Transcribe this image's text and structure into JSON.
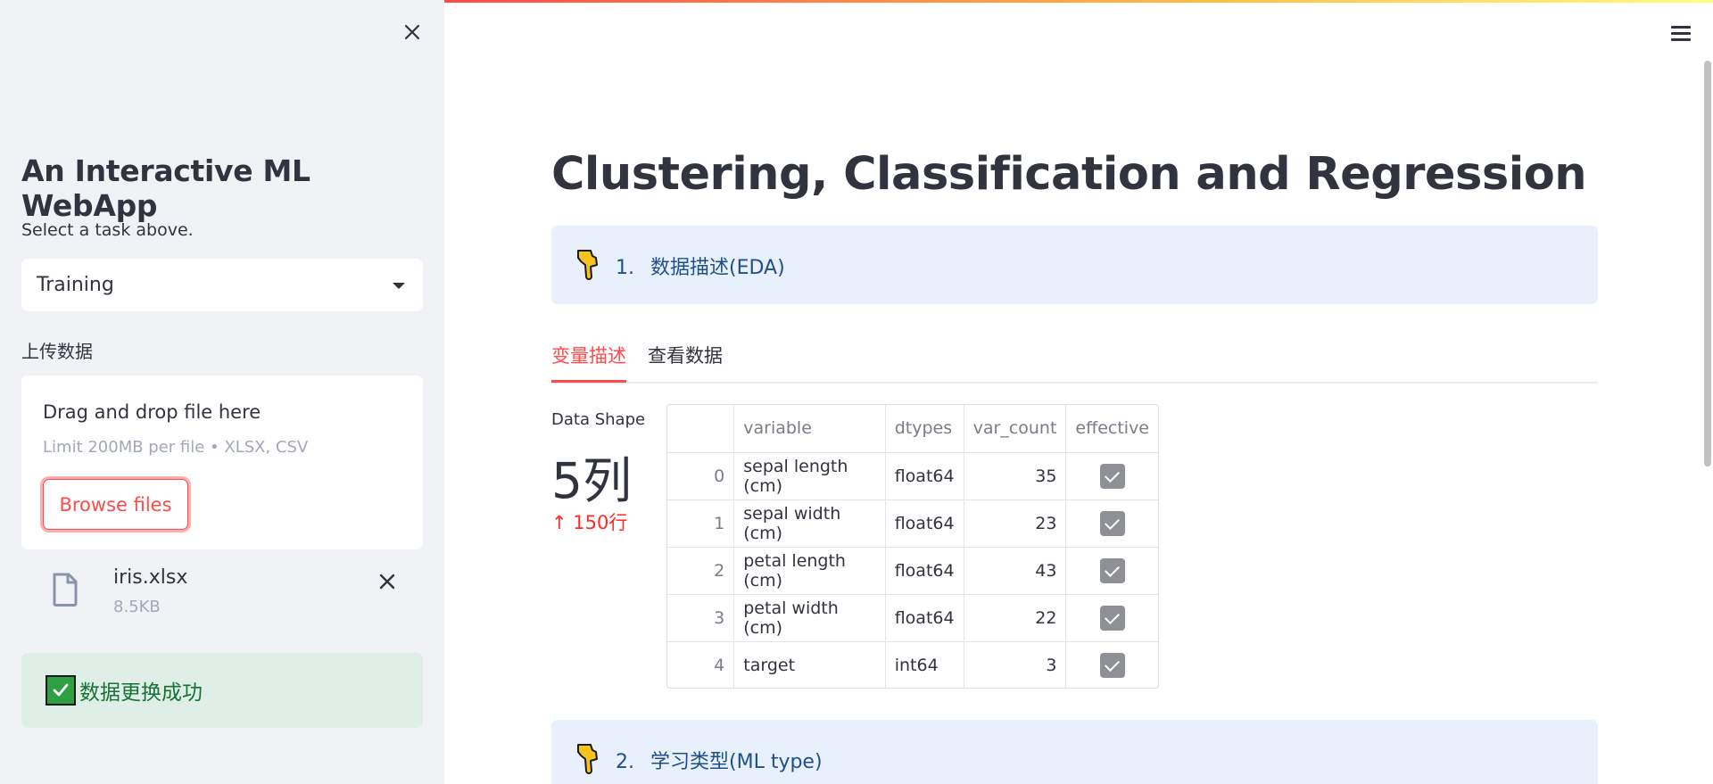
{
  "sidebar": {
    "title": "An Interactive ML WebApp",
    "subtitle": "Select a task above.",
    "task_select": {
      "value": "Training"
    },
    "upload_label": "上传数据",
    "dropzone": {
      "title": "Drag and drop file here",
      "limit": "Limit 200MB per file • XLSX, CSV",
      "browse_label": "Browse files"
    },
    "file": {
      "name": "iris.xlsx",
      "size": "8.5KB"
    },
    "success_message": "数据更换成功"
  },
  "main": {
    "title": "Clustering, Classification and Regression",
    "sections": [
      {
        "number": "1.",
        "label": "数据描述(EDA)"
      },
      {
        "number": "2.",
        "label": "学习类型(ML type)"
      }
    ],
    "tabs": [
      "变量描述",
      "查看数据"
    ],
    "metric": {
      "label": "Data Shape",
      "value": "5列",
      "delta": "150行"
    },
    "table": {
      "columns": [
        "",
        "variable",
        "dtypes",
        "var_count",
        "effective"
      ],
      "rows": [
        {
          "index": "0",
          "variable": "sepal length (cm)",
          "dtypes": "float64",
          "var_count": "35",
          "effective": true
        },
        {
          "index": "1",
          "variable": "sepal width (cm)",
          "dtypes": "float64",
          "var_count": "23",
          "effective": true
        },
        {
          "index": "2",
          "variable": "petal length (cm)",
          "dtypes": "float64",
          "var_count": "43",
          "effective": true
        },
        {
          "index": "3",
          "variable": "petal width (cm)",
          "dtypes": "float64",
          "var_count": "22",
          "effective": true
        },
        {
          "index": "4",
          "variable": "target",
          "dtypes": "int64",
          "var_count": "3",
          "effective": true
        }
      ]
    }
  },
  "colors": {
    "accent": "#ff4b4b",
    "sidebar_bg": "#f0f2f6",
    "info_bg": "#e8f1fb",
    "success_bg": "#dfefe7",
    "success_text": "#177233"
  },
  "icons": {
    "close": "close-icon",
    "menu": "hamburger-menu-icon",
    "hand": "pointing-down-hand-icon",
    "file": "file-icon",
    "check": "check-mark-icon"
  }
}
